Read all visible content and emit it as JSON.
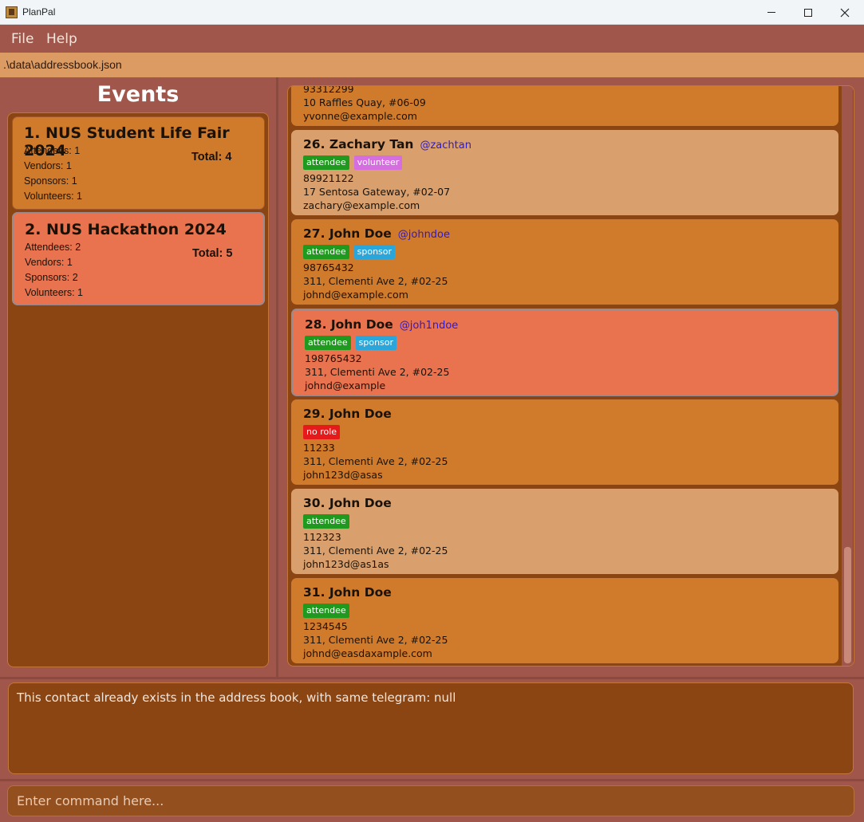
{
  "window": {
    "title": "PlanPal"
  },
  "menu": {
    "file": "File",
    "help": "Help"
  },
  "path": ".\\data\\addressbook.json",
  "events": {
    "heading": "Events",
    "items": [
      {
        "name": "1. NUS Student Life Fair 2024",
        "attendees": "Attendees: 1",
        "vendors": "Vendors: 1",
        "sponsors": "Sponsors: 1",
        "volunteers": "Volunteers: 1",
        "total": "Total: 4"
      },
      {
        "name": "2. NUS Hackathon 2024",
        "attendees": "Attendees: 2",
        "vendors": "Vendors: 1",
        "sponsors": "Sponsors: 2",
        "volunteers": "Volunteers: 1",
        "total": "Total: 5"
      }
    ]
  },
  "contacts": [
    {
      "phone": "93312299",
      "address": "10 Raffles Quay, #06-09",
      "email": "yvonne@example.com"
    },
    {
      "name": "26. Zachary Tan",
      "telegram": "@zachtan",
      "tags": [
        "attendee",
        "volunteer"
      ],
      "phone": "89921122",
      "address": "17 Sentosa Gateway, #02-07",
      "email": "zachary@example.com"
    },
    {
      "name": "27. John Doe",
      "telegram": "@johndoe",
      "tags": [
        "attendee",
        "sponsor"
      ],
      "phone": "98765432",
      "address": "311, Clementi Ave 2, #02-25",
      "email": "johnd@example.com"
    },
    {
      "name": "28. John Doe",
      "telegram": "@joh1ndoe",
      "tags": [
        "attendee",
        "sponsor"
      ],
      "phone": "198765432",
      "address": "311, Clementi Ave 2, #02-25",
      "email": "johnd@example"
    },
    {
      "name": "29. John Doe",
      "telegram": "",
      "tags": [
        "no role"
      ],
      "phone": "11233",
      "address": "311, Clementi Ave 2, #02-25",
      "email": "john123d@asas"
    },
    {
      "name": "30. John Doe",
      "telegram": "",
      "tags": [
        "attendee"
      ],
      "phone": "112323",
      "address": "311, Clementi Ave 2, #02-25",
      "email": "john123d@as1as"
    },
    {
      "name": "31. John Doe",
      "telegram": "",
      "tags": [
        "attendee"
      ],
      "phone": "1234545",
      "address": "311, Clementi Ave 2, #02-25",
      "email": "johnd@easdaxample.com"
    }
  ],
  "result": "This contact already exists in the address book, with same telegram: null",
  "command": {
    "placeholder": "Enter command here..."
  },
  "colors": {
    "background": "#a0564a",
    "panel": "#8b4513",
    "card_orange": "#d07a2c",
    "card_tan": "#d9a06d",
    "card_selected": "#e9734f",
    "tag_attendee": "#1f9a1f",
    "tag_volunteer": "#d56edf",
    "tag_sponsor": "#2aa6db",
    "tag_no_role": "#e51b1b",
    "telegram": "#2c1bd0"
  }
}
